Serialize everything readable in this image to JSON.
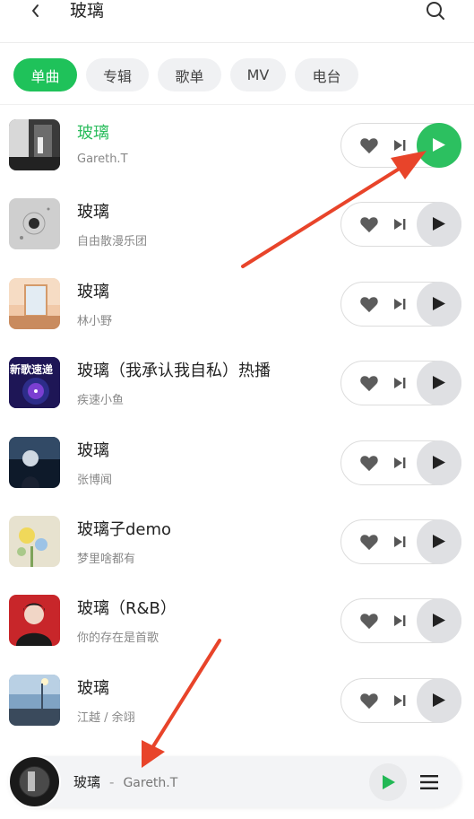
{
  "header": {
    "title": "玻璃",
    "back_icon": "chevron-left-icon",
    "search_icon": "search-icon"
  },
  "tabs": [
    {
      "label": "单曲",
      "active": true
    },
    {
      "label": "专辑",
      "active": false
    },
    {
      "label": "歌单",
      "active": false
    },
    {
      "label": "MV",
      "active": false
    },
    {
      "label": "电台",
      "active": false
    }
  ],
  "songs": [
    {
      "title": "玻璃",
      "artist": "Gareth.T",
      "playing": true
    },
    {
      "title": "玻璃",
      "artist": "自由散漫乐团",
      "playing": false
    },
    {
      "title": "玻璃",
      "artist": "林小野",
      "playing": false
    },
    {
      "title": "玻璃（我承认我自私）热播",
      "artist": "疾速小鱼",
      "playing": false,
      "cover_text": "新歌速递"
    },
    {
      "title": "玻璃",
      "artist": "张博闻",
      "playing": false
    },
    {
      "title": "玻璃子demo",
      "artist": "梦里啥都有",
      "playing": false
    },
    {
      "title": "玻璃（R&B）",
      "artist": "你的存在是首歌",
      "playing": false
    },
    {
      "title": "玻璃",
      "artist": "江越 / 余翊",
      "playing": false
    }
  ],
  "mini_player": {
    "title": "玻璃",
    "separator": "-",
    "artist": "Gareth.T"
  },
  "colors": {
    "accent": "#1fc25a",
    "arrow": "#e8442a"
  }
}
